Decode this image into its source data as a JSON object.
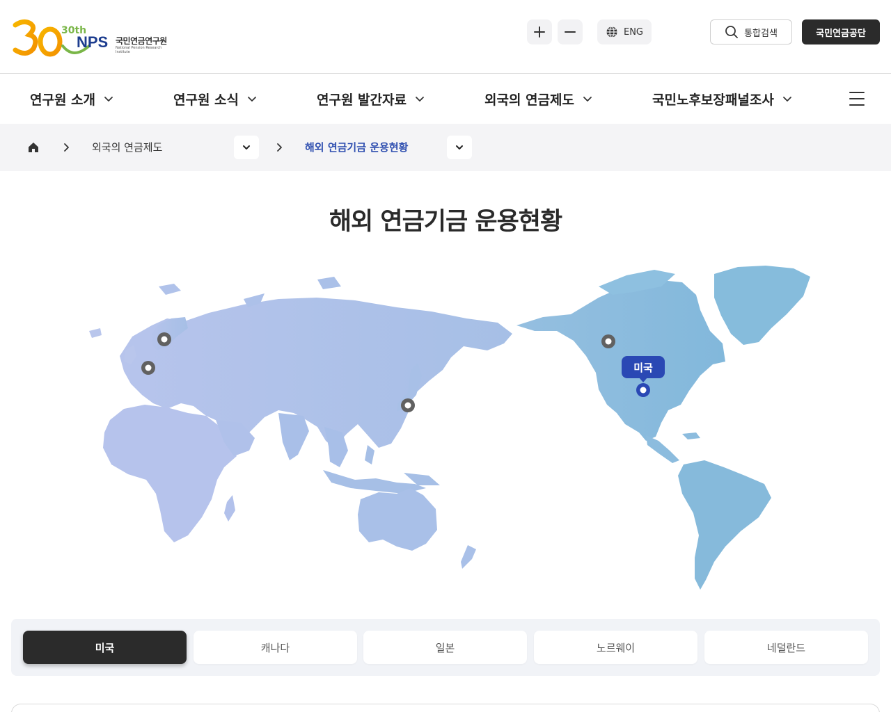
{
  "header": {
    "logo_mark": "30th",
    "logo_brand": "NPS",
    "logo_name": "국민연금연구원",
    "logo_sub": "National Pension Research Institute",
    "lang_label": "ENG",
    "search_label": "통합검색",
    "nps_label": "국민연금공단"
  },
  "gnb": {
    "items": [
      {
        "label": "연구원 소개"
      },
      {
        "label": "연구원 소식"
      },
      {
        "label": "연구원 발간자료"
      },
      {
        "label": "외국의 연금제도"
      },
      {
        "label": "국민노후보장패널조사"
      }
    ]
  },
  "breadcrumb": {
    "level1": "외국의 연금제도",
    "level2": "해외 연금기금 운용현황"
  },
  "page": {
    "title": "해외 연금기금 운용현황"
  },
  "map": {
    "selected_label": "미국",
    "pins": [
      "노르웨이",
      "네덜란드",
      "일본",
      "캐나다",
      "미국"
    ]
  },
  "tabs": {
    "items": [
      {
        "label": "미국",
        "active": true
      },
      {
        "label": "캐나다",
        "active": false
      },
      {
        "label": "일본",
        "active": false
      },
      {
        "label": "노르웨이",
        "active": false
      },
      {
        "label": "네덜란드",
        "active": false
      }
    ]
  },
  "colors": {
    "accent": "#2a48b4",
    "dark": "#2b2b2b",
    "map_left": "#b8c6ec",
    "map_right": "#88bcdc"
  }
}
